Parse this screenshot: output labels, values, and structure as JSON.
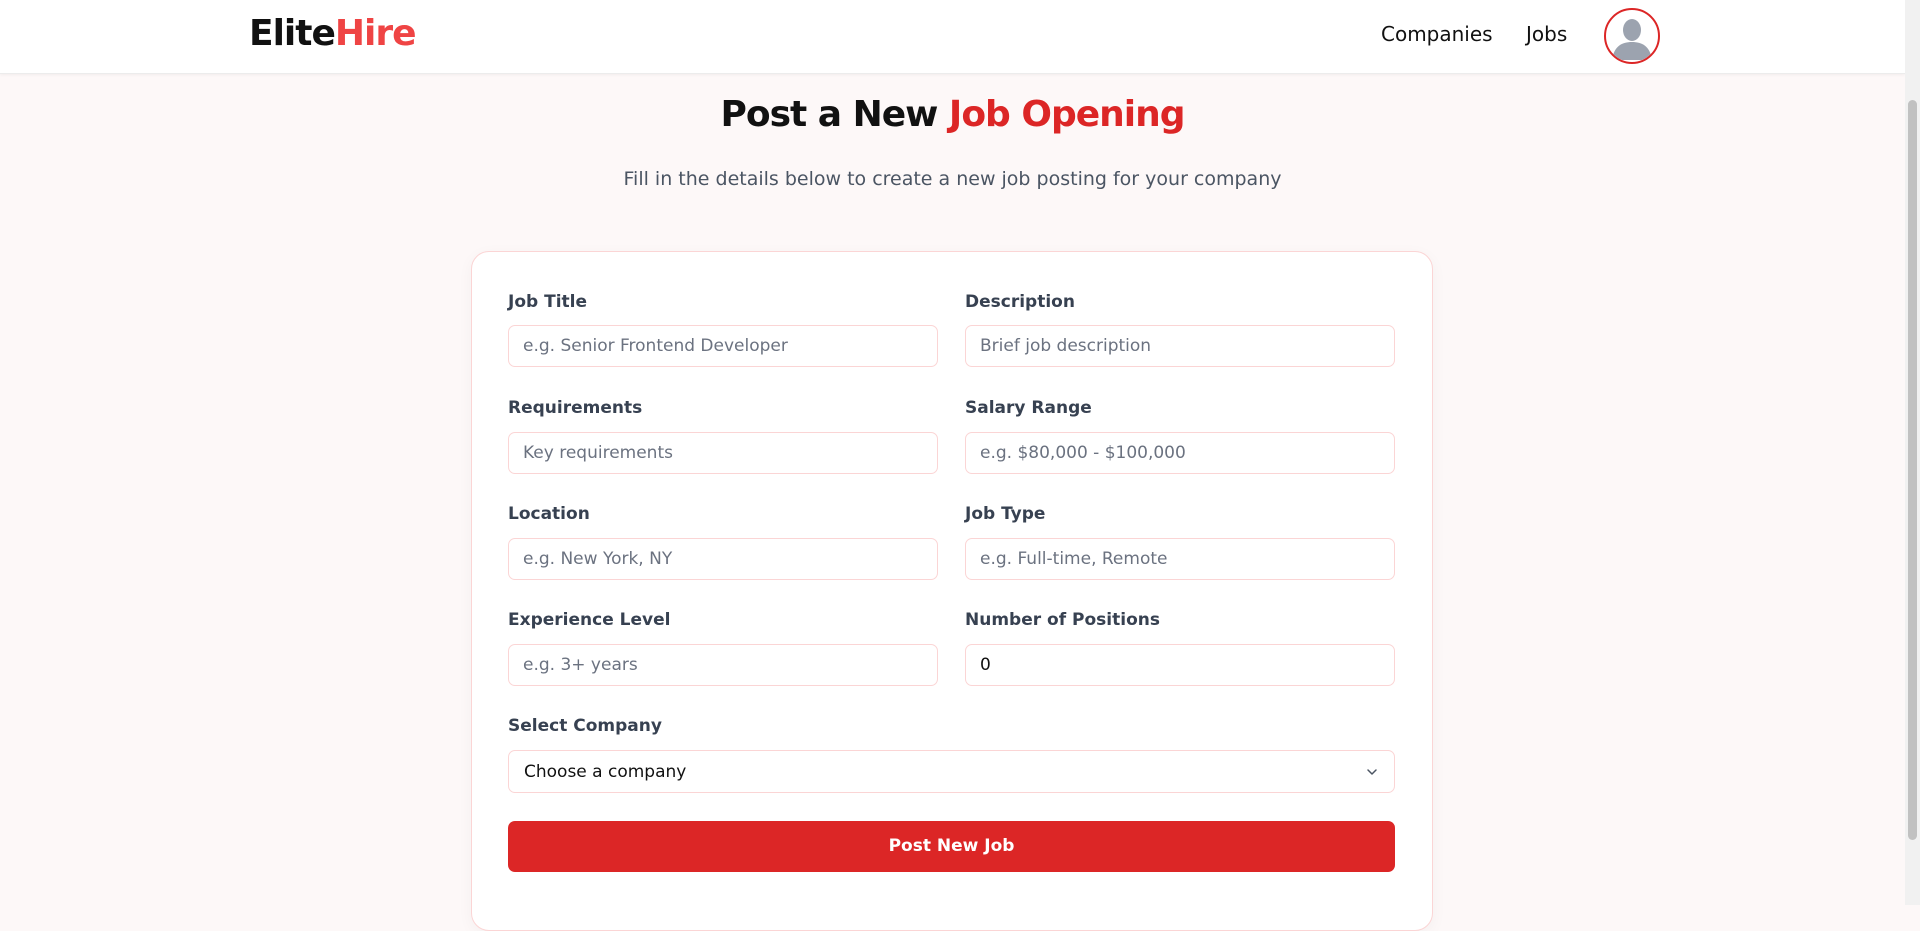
{
  "brand": {
    "part1": "Elite",
    "part2": "Hire"
  },
  "nav": {
    "companies": "Companies",
    "jobs": "Jobs"
  },
  "header": {
    "title_plain": "Post a New ",
    "title_accent": "Job Opening",
    "subtitle": "Fill in the details below to create a new job posting for your company"
  },
  "form": {
    "job_title": {
      "label": "Job Title",
      "placeholder": "e.g. Senior Frontend Developer",
      "value": ""
    },
    "description": {
      "label": "Description",
      "placeholder": "Brief job description",
      "value": ""
    },
    "requirements": {
      "label": "Requirements",
      "placeholder": "Key requirements",
      "value": ""
    },
    "salary": {
      "label": "Salary Range",
      "placeholder": "e.g. $80,000 - $100,000",
      "value": ""
    },
    "location": {
      "label": "Location",
      "placeholder": "e.g. New York, NY",
      "value": ""
    },
    "job_type": {
      "label": "Job Type",
      "placeholder": "e.g. Full-time, Remote",
      "value": ""
    },
    "experience": {
      "label": "Experience Level",
      "placeholder": "e.g. 3+ years",
      "value": ""
    },
    "positions": {
      "label": "Number of Positions",
      "value": "0"
    },
    "company": {
      "label": "Select Company",
      "selected": "Choose a company"
    },
    "submit_label": "Post New Job"
  },
  "colors": {
    "accent": "#dc2626",
    "brand_accent": "#ef4444",
    "border": "#fbd5d5"
  },
  "icons": {
    "avatar": "user-silhouette-icon",
    "select": "chevron-down-icon"
  }
}
